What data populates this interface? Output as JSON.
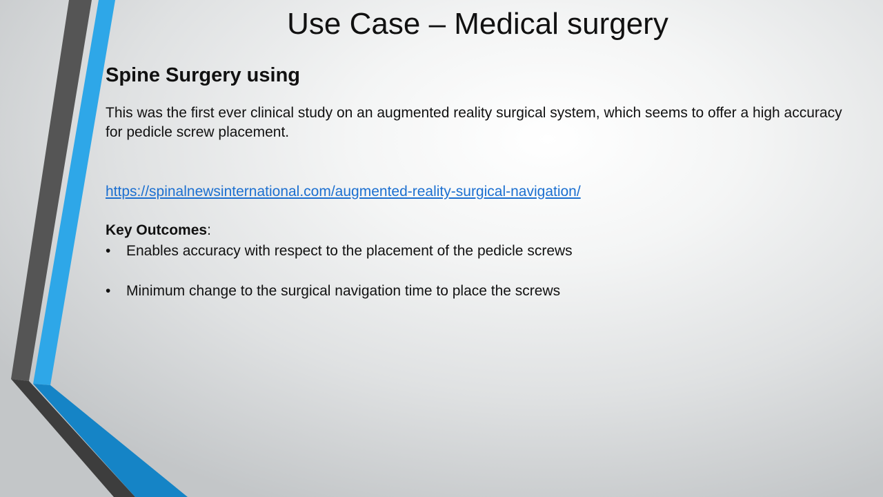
{
  "slide": {
    "title": "Use Case – Medical surgery",
    "subtitle": "Spine Surgery using",
    "description": "This was the first ever clinical study on an augmented reality surgical system, which seems to offer a high accuracy for pedicle screw placement.",
    "link": "https://spinalnewsinternational.com/augmented-reality-surgical-navigation/",
    "key_outcomes_label": "Key Outcomes",
    "key_outcomes_suffix": ":",
    "bullet_symbol": "•",
    "bullets": [
      "Enables accuracy with respect to the placement of the pedicle screws",
      "Minimum change to the surgical navigation time to place the screws"
    ]
  },
  "colors": {
    "accent_blue": "#2ea7e8",
    "dark_blue": "#1584c6",
    "dark_gray": "#555555",
    "link": "#1b6fd0"
  }
}
